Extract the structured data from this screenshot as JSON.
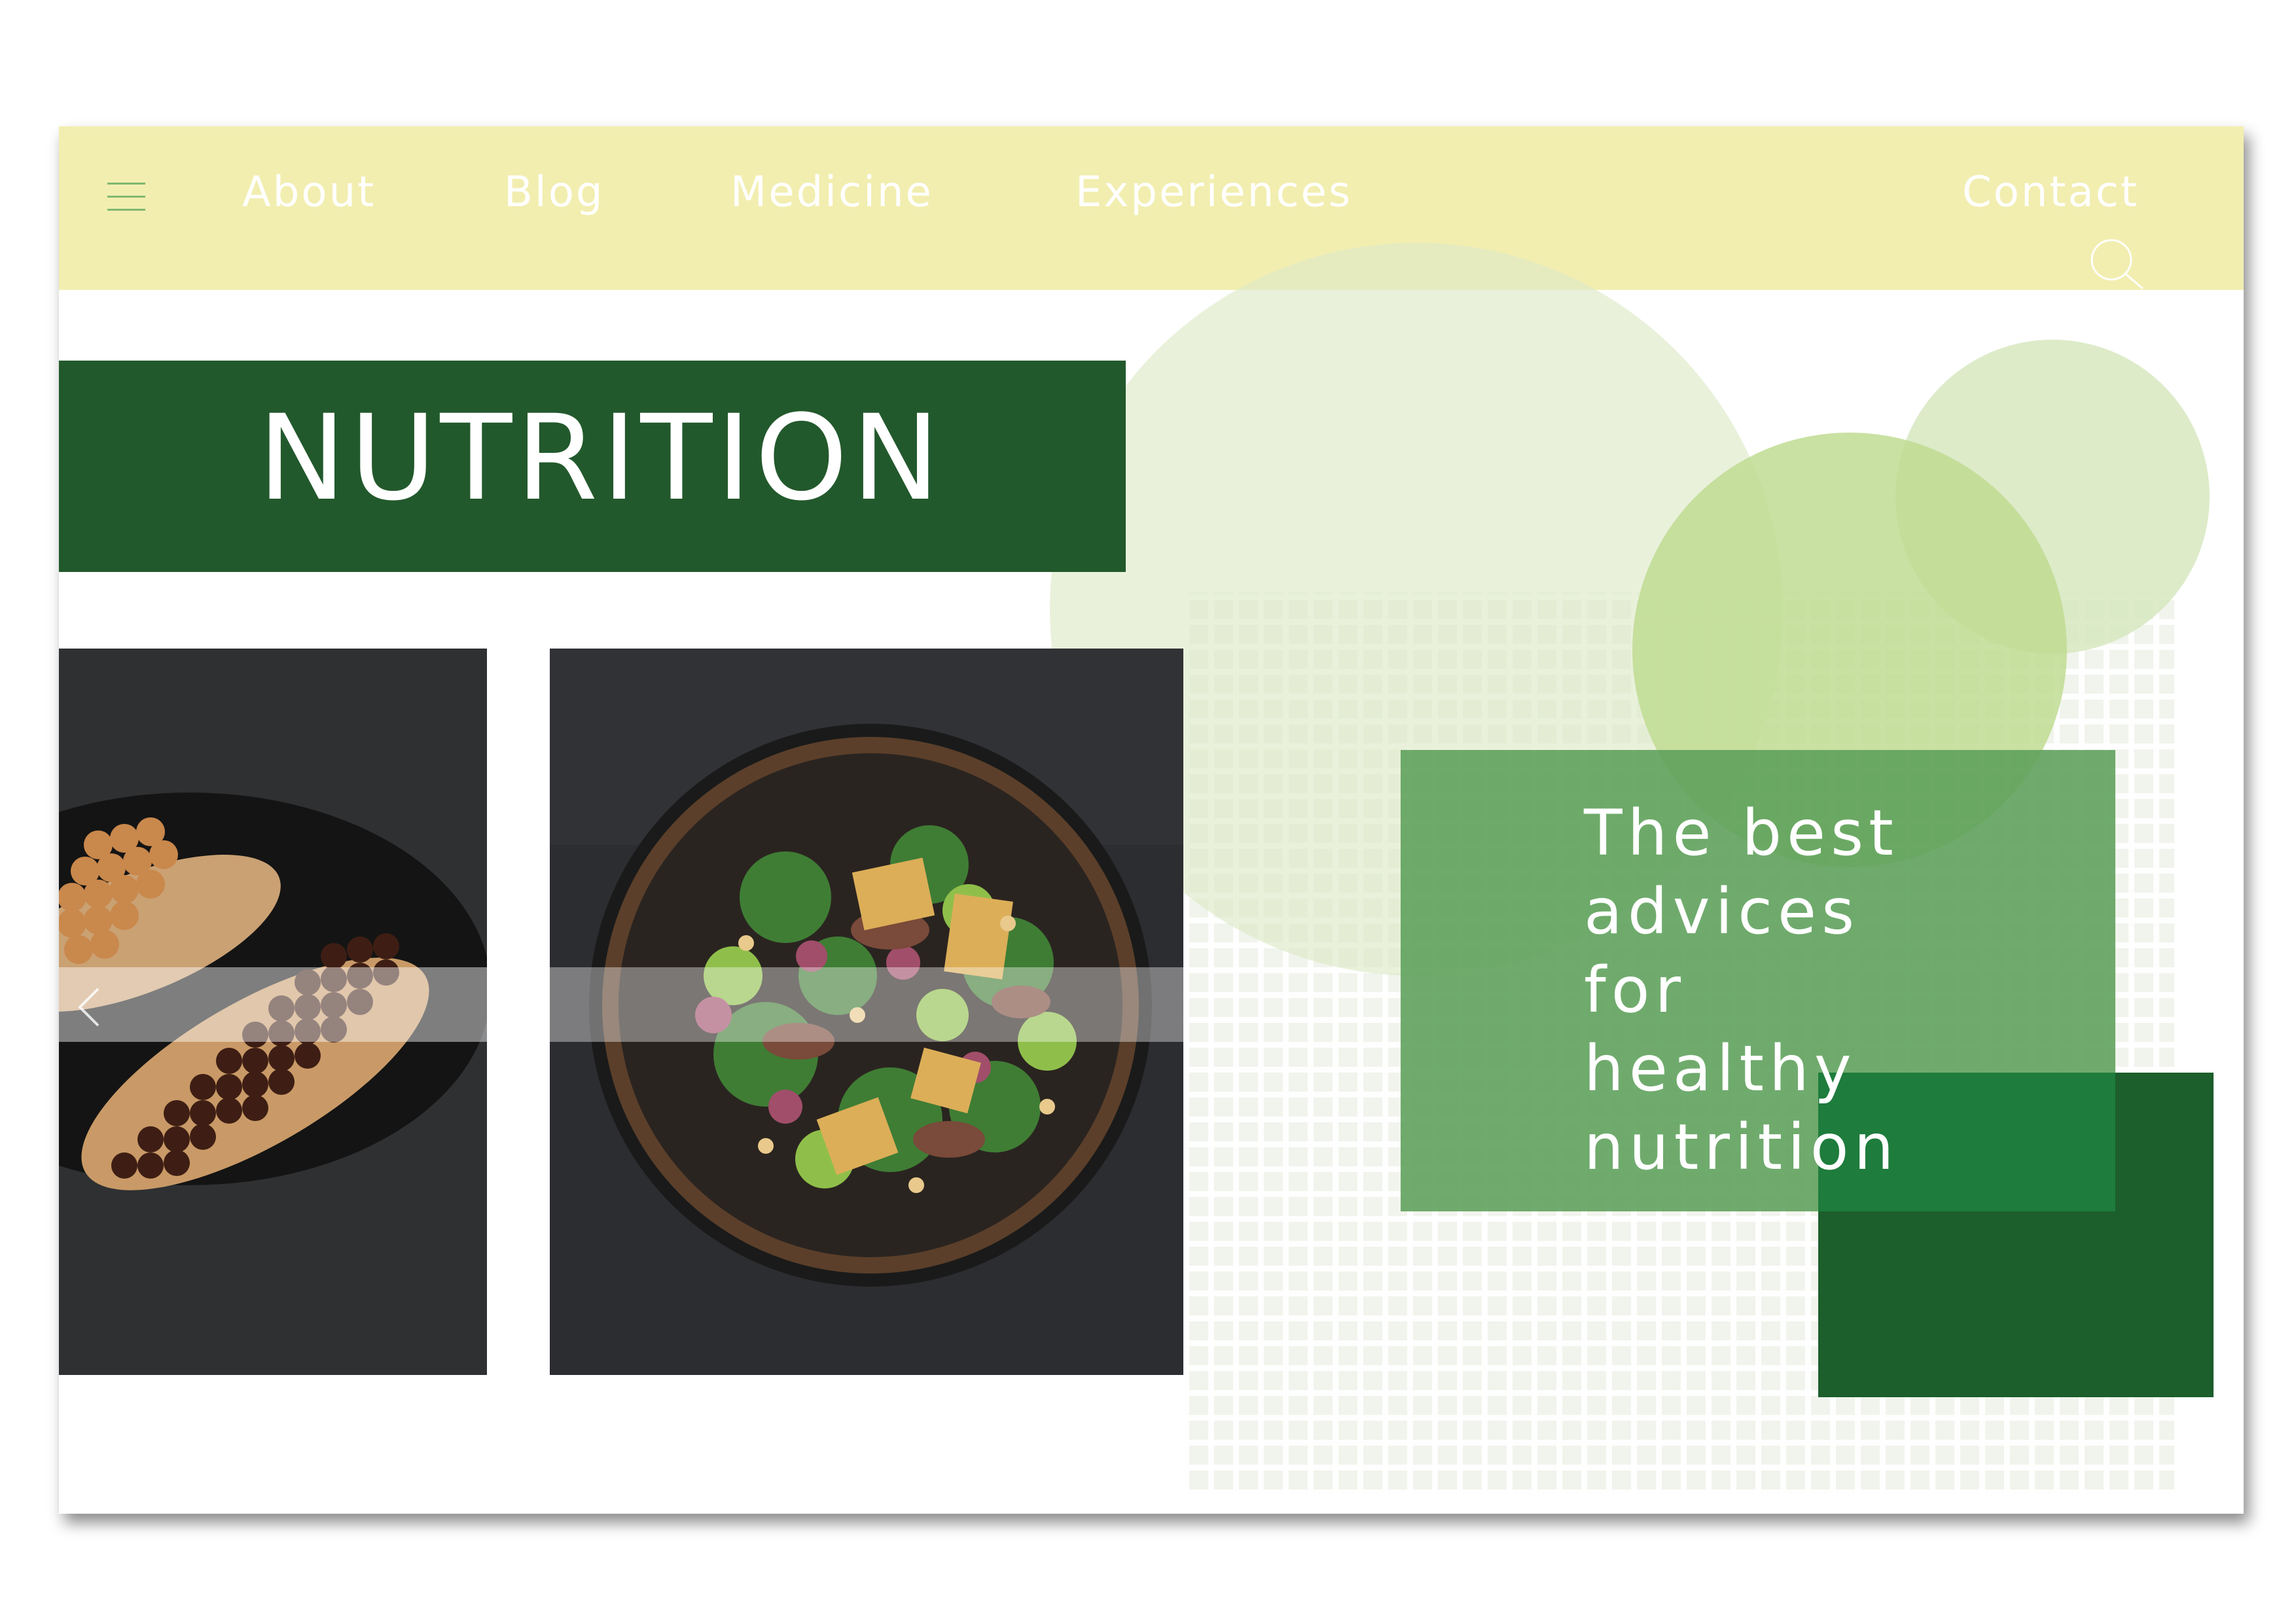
{
  "nav": {
    "menu_icon": "hamburger-icon",
    "links": [
      "About",
      "Blog",
      "Medicine",
      "Experiences"
    ],
    "contact": "Contact",
    "search_icon": "search-icon"
  },
  "hero": {
    "title": "NUTRITION",
    "tagline_lines": [
      "The best",
      "advices",
      "for",
      "healthy",
      "nutrition"
    ]
  },
  "gallery": {
    "photos": [
      {
        "name": "eclair-photo",
        "subject": "chocolate eclairs"
      },
      {
        "name": "salad-bowl-photo",
        "subject": "salad bowl"
      }
    ],
    "prev_icon": "chevron-left-icon"
  },
  "colors": {
    "nav_bg": "#f2eeb0",
    "title_bg": "#22592c",
    "accent_green": "#5c9f5a",
    "dark_green": "#1c5e2c",
    "light_green": "#e6f0d8"
  }
}
